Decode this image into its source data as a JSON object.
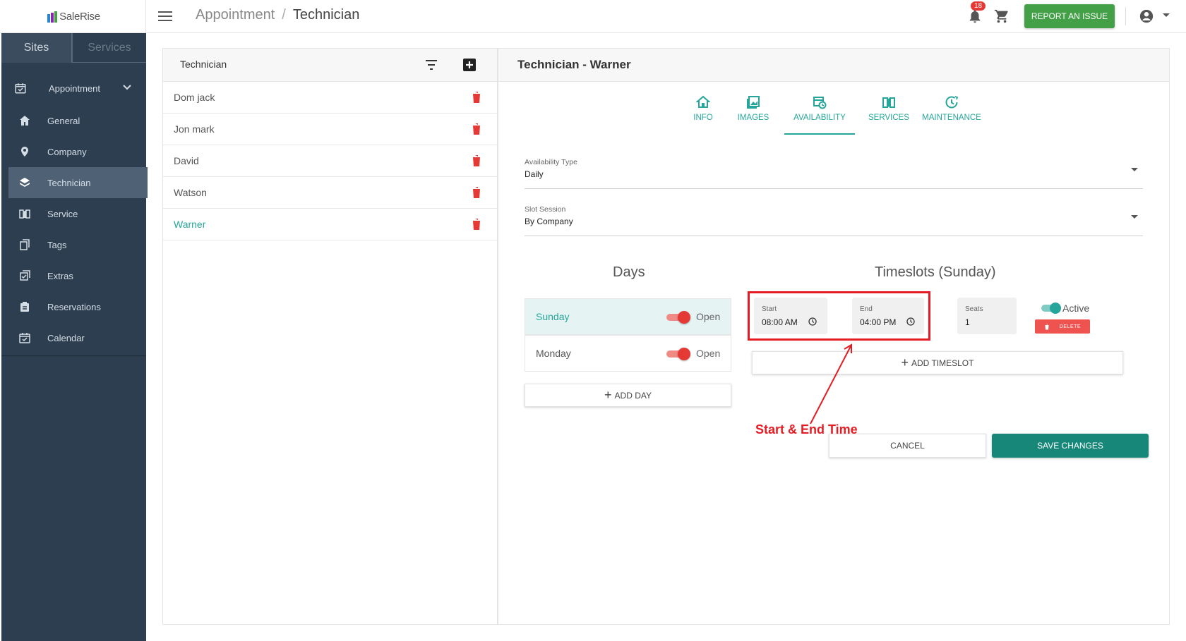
{
  "app": {
    "logo_text": "SaleRise"
  },
  "header": {
    "breadcrumb": [
      "Appointment",
      "Technician"
    ],
    "notifications_count": "18",
    "report_button": "REPORT AN ISSUE"
  },
  "sidebar": {
    "tabs": [
      "Sites",
      "Services"
    ],
    "group": {
      "label": "Appointment"
    },
    "items": [
      {
        "label": "General",
        "icon": "home-icon"
      },
      {
        "label": "Company",
        "icon": "location-pin-icon"
      },
      {
        "label": "Technician",
        "icon": "layers-icon",
        "active": true
      },
      {
        "label": "Service",
        "icon": "book-icon"
      },
      {
        "label": "Tags",
        "icon": "tag-icon"
      },
      {
        "label": "Extras",
        "icon": "checklist-icon"
      },
      {
        "label": "Reservations",
        "icon": "clipboard-icon"
      },
      {
        "label": "Calendar",
        "icon": "calendar-icon"
      }
    ]
  },
  "list": {
    "title": "Technician",
    "rows": [
      {
        "name": "Dom jack"
      },
      {
        "name": "Jon mark"
      },
      {
        "name": "David"
      },
      {
        "name": "Watson"
      },
      {
        "name": "Warner",
        "selected": true
      }
    ]
  },
  "detail": {
    "title": "Technician - Warner",
    "tabs": [
      {
        "label": "INFO",
        "icon": "home-icon"
      },
      {
        "label": "IMAGES",
        "icon": "image-icon"
      },
      {
        "label": "AVAILABILITY",
        "icon": "calendar-clock-icon",
        "active": true
      },
      {
        "label": "SERVICES",
        "icon": "book-icon"
      },
      {
        "label": "MAINTENANCE",
        "icon": "wrench-clock-icon"
      }
    ],
    "availability_type": {
      "label": "Availability Type",
      "value": "Daily"
    },
    "slot_session": {
      "label": "Slot Session",
      "value": "By Company"
    },
    "days_title": "Days",
    "days": [
      {
        "name": "Sunday",
        "status": "Open",
        "active": true
      },
      {
        "name": "Monday",
        "status": "Open"
      }
    ],
    "add_day": "ADD DAY",
    "timeslots_title": "Timeslots (Sunday)",
    "timeslot": {
      "start_label": "Start",
      "start_value": "08:00 AM",
      "end_label": "End",
      "end_value": "04:00 PM",
      "seats_label": "Seats",
      "seats_value": "1",
      "active_label": "Active",
      "delete_label": "DELETE"
    },
    "add_timeslot": "ADD TIMESLOT",
    "annotation": "Start & End Time",
    "cancel": "CANCEL",
    "save": "SAVE CHANGES"
  },
  "colors": {
    "accent": "#26a69a",
    "sidebar": "#2d3e50",
    "danger": "#e53935",
    "report": "#43a047",
    "save": "#17877a"
  }
}
